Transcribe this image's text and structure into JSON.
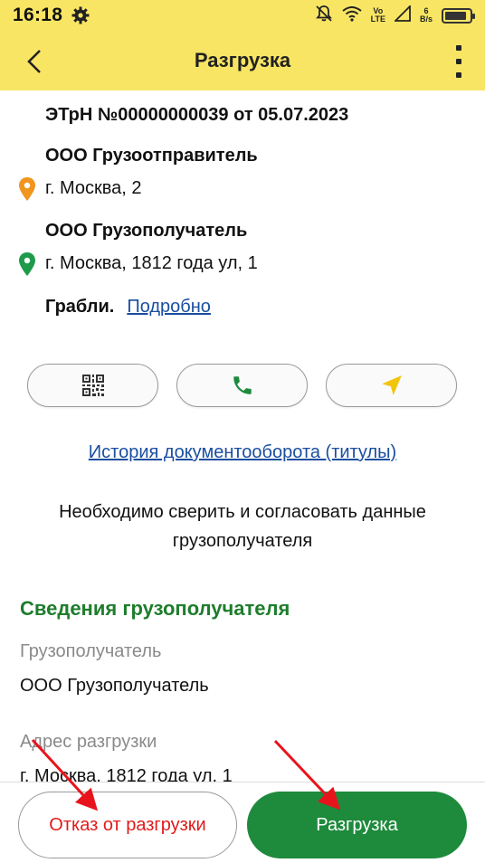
{
  "status_bar": {
    "time": "16:18",
    "network_top": "Vo",
    "network_bottom": "LTE",
    "speed_top": "6",
    "speed_bottom": "B/s",
    "battery_level": 0.9
  },
  "app_bar": {
    "title": "Разгрузка"
  },
  "document": {
    "title": "ЭТрН №00000000039 от 05.07.2023"
  },
  "sender": {
    "name": "ООО Грузоотправитель",
    "address": "г. Москва, 2",
    "pin_color": "#f0951e"
  },
  "receiver": {
    "name": "ООО Грузополучатель",
    "address": "г. Москва, 1812 года ул, 1",
    "pin_color": "#1e9a4a"
  },
  "cargo": {
    "name": "Грабли.",
    "details_link": "Подробно"
  },
  "actions": [
    {
      "icon": "qr-code-icon"
    },
    {
      "icon": "phone-icon",
      "color": "#1e8a3c"
    },
    {
      "icon": "navigation-arrow-icon",
      "color": "#f2c40a"
    }
  ],
  "history_link": "История документооборота (титулы)",
  "notice": "Необходимо сверить и согласовать данные грузополучателя",
  "receiver_info": {
    "section_title": "Сведения грузополучателя",
    "consignee_label": "Грузополучатель",
    "consignee_value": "ООО Грузополучатель",
    "address_label": "Адрес разгрузки",
    "address_value": "г. Москва, 1812 года ул, 1"
  },
  "bottom": {
    "refuse_label": "Отказ от разгрузки",
    "unload_label": "Разгрузка"
  },
  "colors": {
    "header_yellow": "#f8e564",
    "accent_green": "#1e8a3c",
    "section_green": "#1e7d2c",
    "refuse_red": "#e01b1b",
    "link_blue": "#1a4ea0",
    "annotation_red": "#e8141c"
  }
}
